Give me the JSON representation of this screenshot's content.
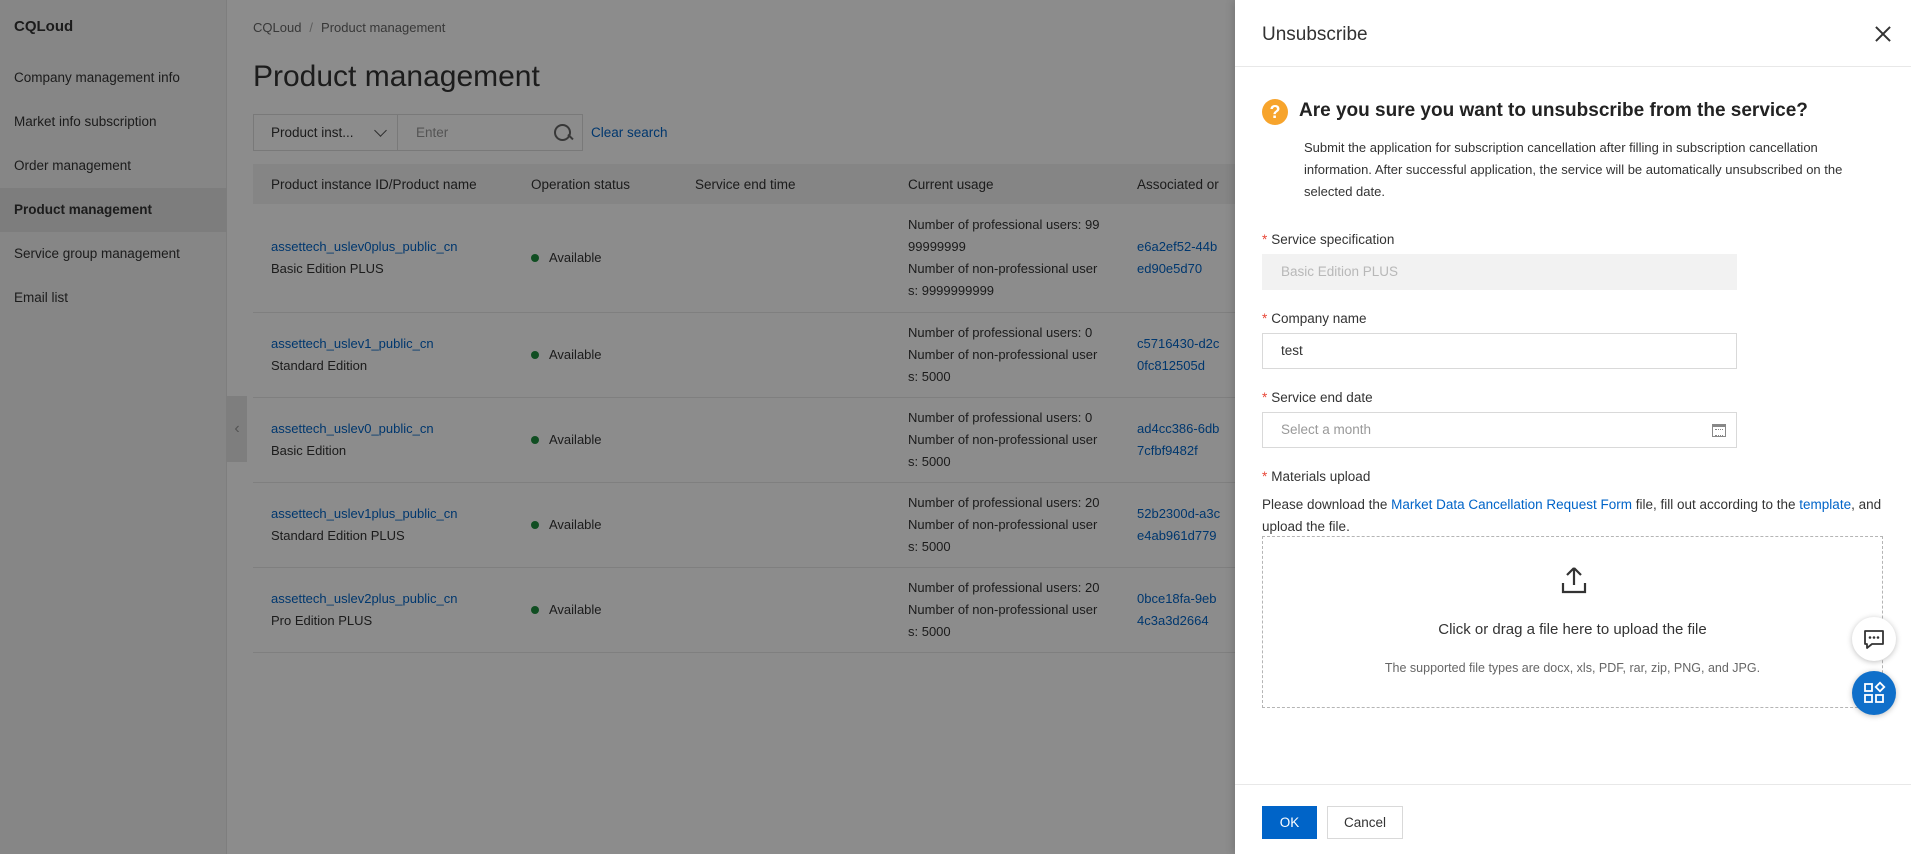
{
  "app": {
    "brand": "CQLoud",
    "nav": [
      {
        "label": "Company management info"
      },
      {
        "label": "Market info subscription"
      },
      {
        "label": "Order management"
      },
      {
        "label": "Product management",
        "active": true
      },
      {
        "label": "Service group management"
      },
      {
        "label": "Email list"
      }
    ],
    "breadcrumb": {
      "root": "CQLoud",
      "separator": "/",
      "current": "Product management"
    },
    "page_title": "Product management",
    "search": {
      "select_value": "Product inst...",
      "placeholder": "Enter",
      "clear_label": "Clear search"
    },
    "table": {
      "headers": [
        "Product instance ID/Product name",
        "Operation status",
        "Service end time",
        "Current usage",
        "Associated or"
      ],
      "rows": [
        {
          "id": "assettech_uslev0plus_public_cn",
          "name": "Basic Edition PLUS",
          "status": "Available",
          "end_time": "",
          "usage": [
            "Number of professional users: 99",
            "99999999",
            "Number of non-professional user",
            "s: 9999999999"
          ],
          "assoc": [
            "e6a2ef52-44b",
            "ed90e5d70"
          ]
        },
        {
          "id": "assettech_uslev1_public_cn",
          "name": "Standard Edition",
          "status": "Available",
          "end_time": "",
          "usage": [
            "Number of professional users: 0",
            "Number of non-professional user",
            "s: 5000"
          ],
          "assoc": [
            "c5716430-d2c",
            "0fc812505d"
          ]
        },
        {
          "id": "assettech_uslev0_public_cn",
          "name": "Basic Edition",
          "status": "Available",
          "end_time": "",
          "usage": [
            "Number of professional users: 0",
            "Number of non-professional user",
            "s: 5000"
          ],
          "assoc": [
            "ad4cc386-6db",
            "7cfbf9482f"
          ]
        },
        {
          "id": "assettech_uslev1plus_public_cn",
          "name": "Standard Edition PLUS",
          "status": "Available",
          "end_time": "",
          "usage": [
            "Number of professional users: 20",
            "Number of non-professional user",
            "s: 5000"
          ],
          "assoc": [
            "52b2300d-a3c",
            "e4ab961d779"
          ]
        },
        {
          "id": "assettech_uslev2plus_public_cn",
          "name": "Pro Edition PLUS",
          "status": "Available",
          "end_time": "",
          "usage": [
            "Number of professional users: 20",
            "Number of non-professional user",
            "s: 5000"
          ],
          "assoc": [
            "0bce18fa-9eb",
            "4c3a3d2664"
          ]
        }
      ]
    }
  },
  "drawer": {
    "title": "Unsubscribe",
    "confirm_title": "Are you sure you want to unsubscribe from the service?",
    "confirm_desc": "Submit the application for subscription cancellation after filling in subscription cancellation information. After successful application, the service will be automatically unsubscribed on the selected date.",
    "required_mark": "*",
    "fields": {
      "spec": {
        "label": "Service specification",
        "value": "Basic Edition PLUS"
      },
      "company": {
        "label": "Company name",
        "value": "test"
      },
      "end_date": {
        "label": "Service end date",
        "placeholder": "Select a month"
      },
      "materials": {
        "label": "Materials upload"
      }
    },
    "upload": {
      "text_1": "Please download the ",
      "form_link": "Market Data Cancellation Request Form",
      "text_2": " file, fill out according to the ",
      "template_link": "template",
      "text_3": ", and upload the file.",
      "drop_main": "Click or drag a file here to upload the file",
      "drop_sub": "The supported file types are docx, xls, PDF, rar, zip, PNG, and JPG."
    },
    "ok_label": "OK",
    "cancel_label": "Cancel"
  },
  "colors": {
    "primary": "#0064c8",
    "required": "#e84738",
    "warning_icon": "#f7a42c",
    "status_available": "#1e8e3e"
  },
  "icons": [
    "question-icon",
    "close-icon",
    "calendar-icon",
    "upload-icon",
    "chevron-down-icon",
    "search-icon",
    "chat-icon",
    "apps-icon"
  ]
}
